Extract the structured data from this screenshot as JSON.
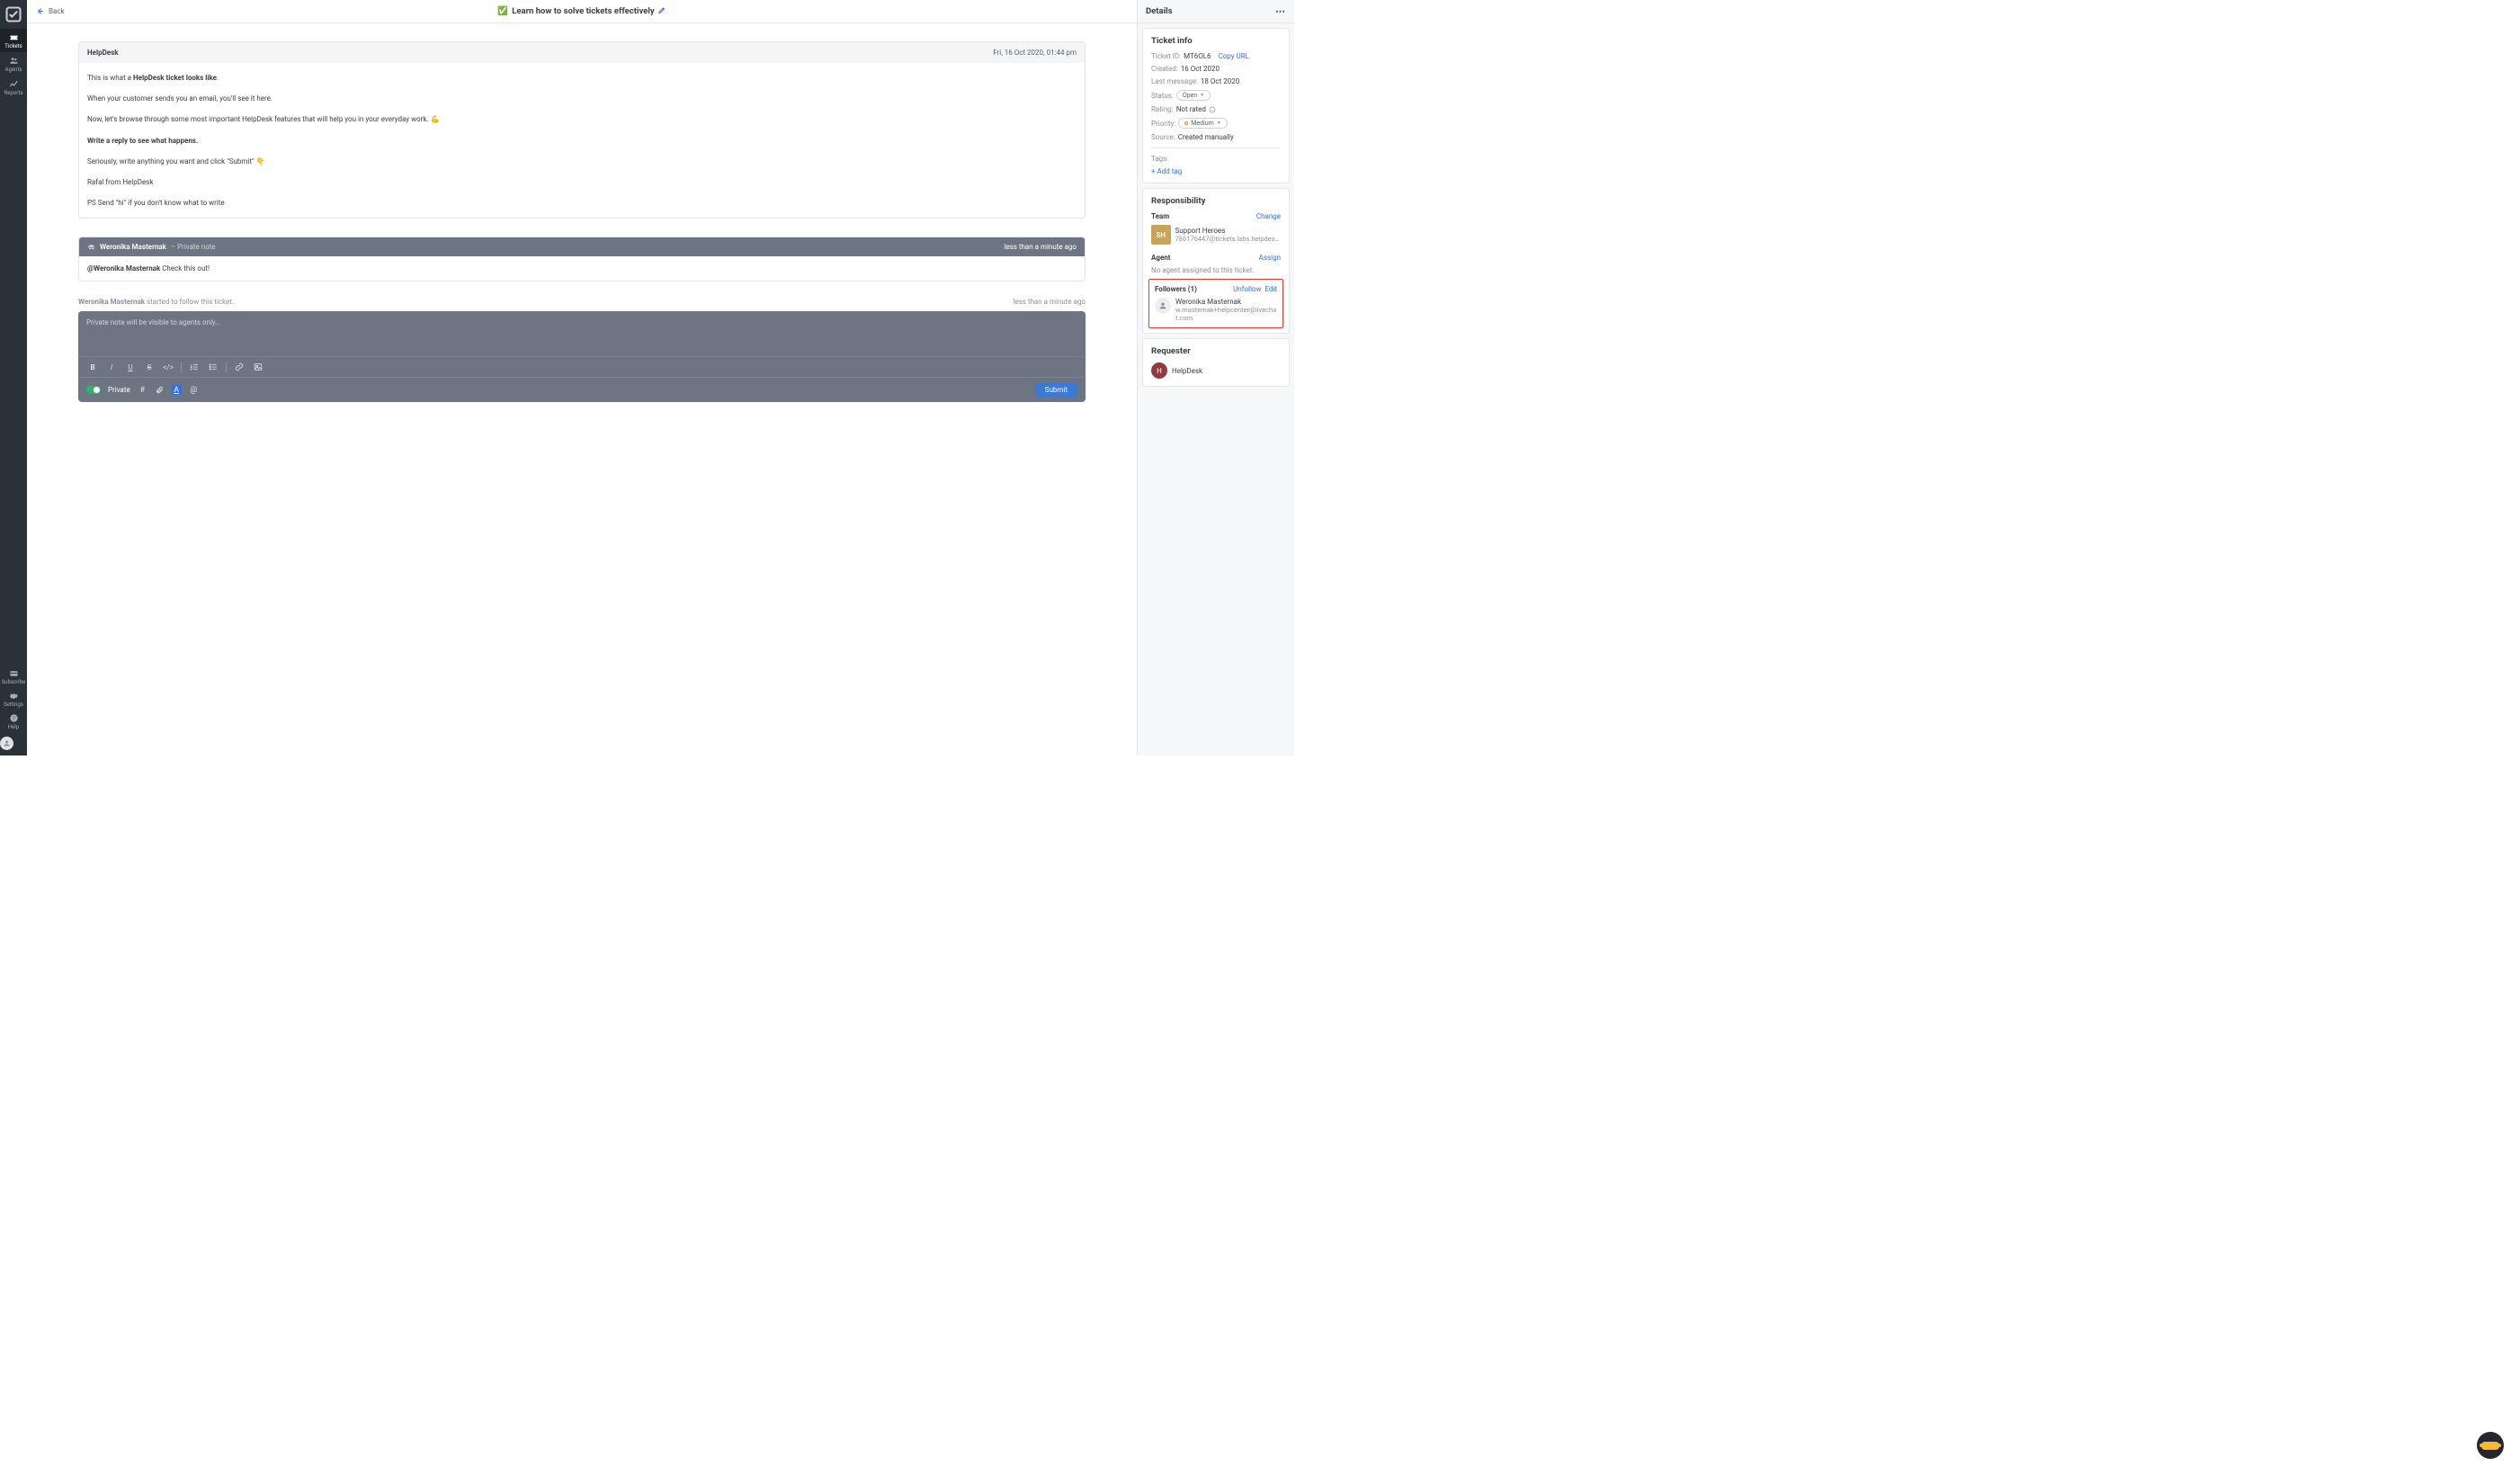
{
  "sidebar": {
    "items": [
      {
        "label": "Tickets"
      },
      {
        "label": "Agents"
      },
      {
        "label": "Reports"
      }
    ],
    "bottom": [
      {
        "label": "Subscribe"
      },
      {
        "label": "Settings"
      },
      {
        "label": "Help"
      }
    ]
  },
  "topbar": {
    "back_label": "Back",
    "title_emoji": "✅",
    "title": "Learn how to solve tickets effectively"
  },
  "message": {
    "from": "HelpDesk",
    "time": "Fri, 16 Oct 2020, 01:44 pm",
    "body_intro_prefix": "This is what a ",
    "body_intro_bold": "HelpDesk ticket looks like",
    "body_line2": "When your customer sends you an email, you'll see it here.",
    "body_line3": "Now, let's browse through some most important HelpDesk features that will help you in your everyday work. 💪",
    "body_line4_bold": "Write a reply to see what happens.",
    "body_line5": "Seriously, write anything you want and click \"Submit\" 👇",
    "body_line6": "Rafal from HelpDesk",
    "body_line7": "PS Send \"hi\" if you don't know what to write"
  },
  "note": {
    "author": "Weronika Masternak",
    "tag": "– Private note",
    "time": "less than a minute ago",
    "mention": "@Weronika Masternak",
    "text": " Check this out!"
  },
  "activity": {
    "actor": "Weronika Masternak",
    "text": " started to follow this ticket.",
    "time": "less than a minute ago"
  },
  "composer": {
    "placeholder": "Private note will be visible to agents only…",
    "private_label": "Private",
    "submit_label": "Submit"
  },
  "details": {
    "title": "Details",
    "ticket_info": {
      "heading": "Ticket info",
      "ticket_id_label": "Ticket ID:",
      "ticket_id": "MT6OL6",
      "copy_url": "Copy URL",
      "created_label": "Created:",
      "created": "16 Oct 2020",
      "last_msg_label": "Last message:",
      "last_msg": "18 Oct 2020",
      "status_label": "Status:",
      "status": "Open",
      "rating_label": "Rating:",
      "rating": "Not rated",
      "priority_label": "Priority:",
      "priority": "Medium",
      "source_label": "Source:",
      "source": "Created manually",
      "tags_label": "Tags:",
      "add_tag": "+ Add tag"
    },
    "responsibility": {
      "heading": "Responsibility",
      "team_label": "Team",
      "change": "Change",
      "team_initials": "SH",
      "team_name": "Support Heroes",
      "team_email": "786176447@tickets.labs.helpdesk…",
      "agent_label": "Agent",
      "assign": "Assign",
      "no_agent": "No agent assigned to this ticket.",
      "followers_label": "Followers (1)",
      "unfollow": "Unfollow",
      "edit": "Edit",
      "follower_name": "Weronika Masternak",
      "follower_email": "w.masternak+helpcenter@livechat.com"
    },
    "requester": {
      "heading": "Requester",
      "name": "HelpDesk",
      "initial": "H"
    }
  }
}
